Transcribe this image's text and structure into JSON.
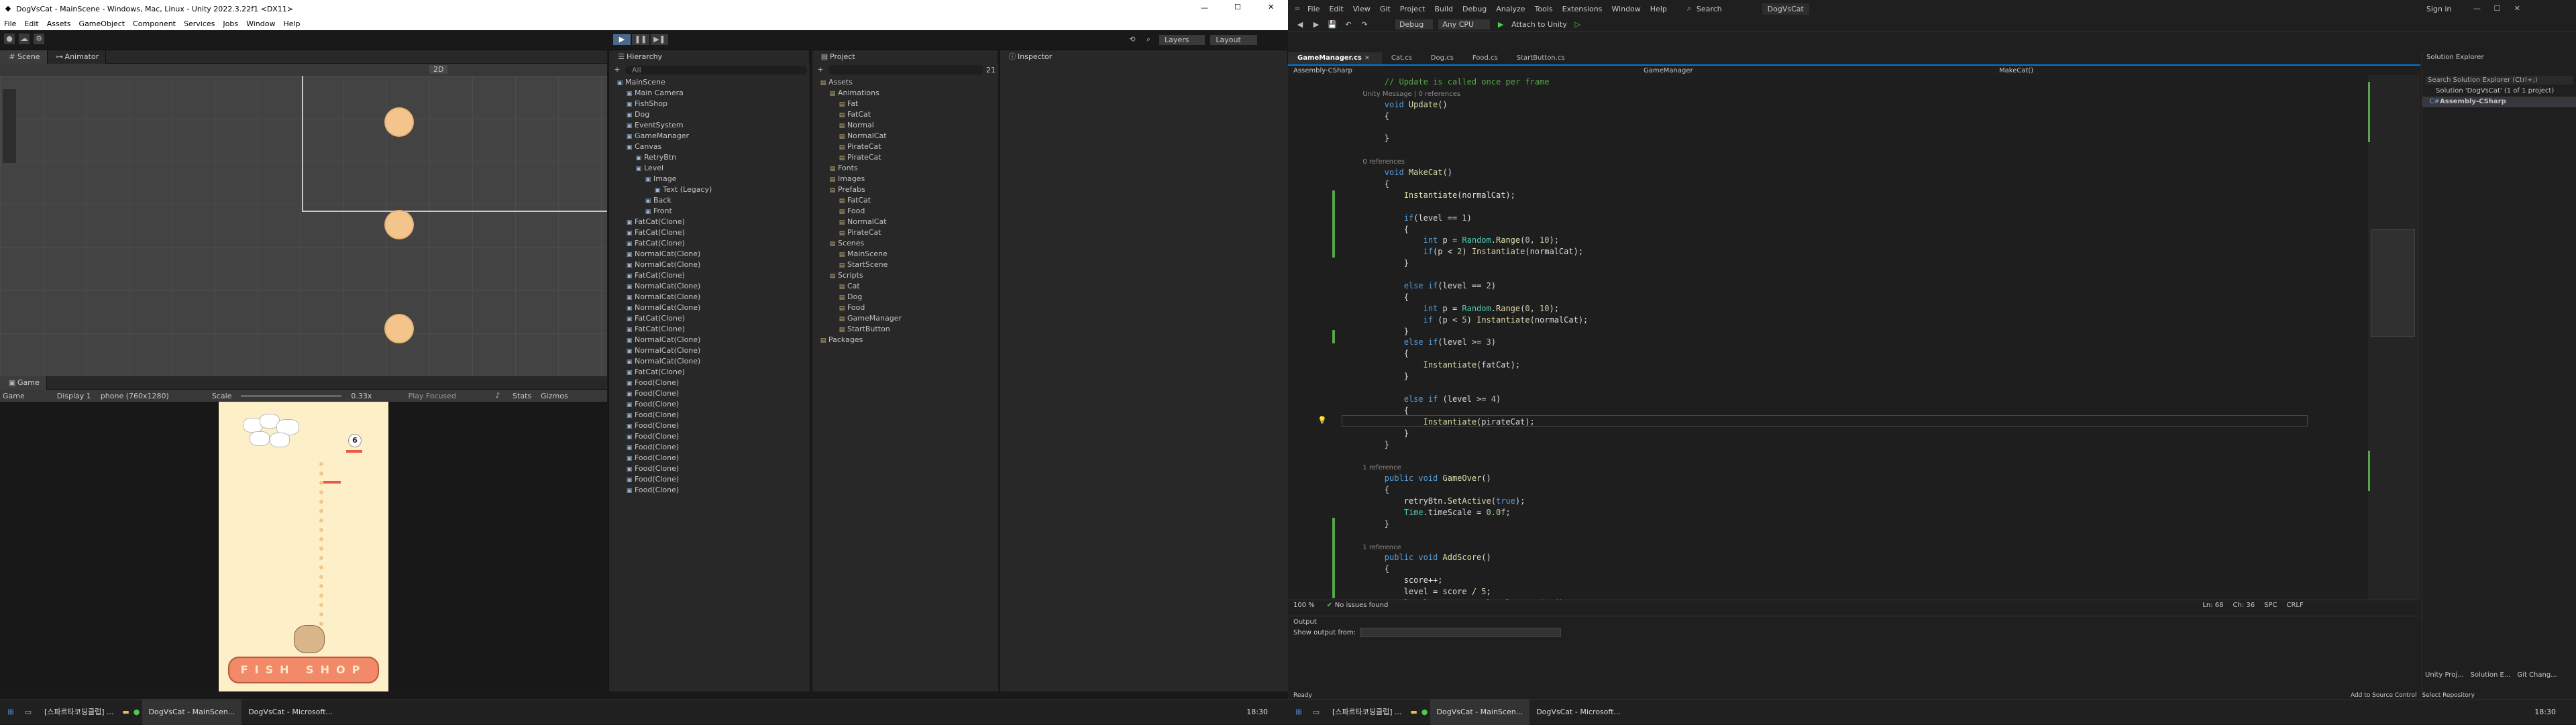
{
  "unity": {
    "title": "DogVsCat - MainScene - Windows, Mac, Linux - Unity 2022.3.22f1 <DX11>",
    "menu": [
      "File",
      "Edit",
      "Assets",
      "GameObject",
      "Component",
      "Services",
      "Jobs",
      "Window",
      "Help"
    ],
    "toolbar": {
      "layers": "Layers",
      "layout": "Layout"
    },
    "scene_tabs": [
      "Scene",
      "Animator"
    ],
    "scene_zoom": "2D",
    "hierarchy": {
      "title": "Hierarchy",
      "search_placeholder": "All",
      "rows": [
        {
          "d": 0,
          "t": "MainScene"
        },
        {
          "d": 1,
          "t": "Main Camera"
        },
        {
          "d": 1,
          "t": "FishShop"
        },
        {
          "d": 1,
          "t": "Dog"
        },
        {
          "d": 1,
          "t": "EventSystem"
        },
        {
          "d": 1,
          "t": "GameManager"
        },
        {
          "d": 1,
          "t": "Canvas"
        },
        {
          "d": 2,
          "t": "RetryBtn"
        },
        {
          "d": 2,
          "t": "Level"
        },
        {
          "d": 3,
          "t": "Image"
        },
        {
          "d": 4,
          "t": "Text (Legacy)"
        },
        {
          "d": 3,
          "t": "Back"
        },
        {
          "d": 3,
          "t": "Front"
        },
        {
          "d": 1,
          "t": "FatCat(Clone)"
        },
        {
          "d": 1,
          "t": "FatCat(Clone)"
        },
        {
          "d": 1,
          "t": "FatCat(Clone)"
        },
        {
          "d": 1,
          "t": "NormalCat(Clone)"
        },
        {
          "d": 1,
          "t": "NormalCat(Clone)"
        },
        {
          "d": 1,
          "t": "FatCat(Clone)"
        },
        {
          "d": 1,
          "t": "NormalCat(Clone)"
        },
        {
          "d": 1,
          "t": "NormalCat(Clone)"
        },
        {
          "d": 1,
          "t": "NormalCat(Clone)"
        },
        {
          "d": 1,
          "t": "FatCat(Clone)"
        },
        {
          "d": 1,
          "t": "FatCat(Clone)"
        },
        {
          "d": 1,
          "t": "NormalCat(Clone)"
        },
        {
          "d": 1,
          "t": "NormalCat(Clone)"
        },
        {
          "d": 1,
          "t": "NormalCat(Clone)"
        },
        {
          "d": 1,
          "t": "FatCat(Clone)"
        },
        {
          "d": 1,
          "t": "Food(Clone)"
        },
        {
          "d": 1,
          "t": "Food(Clone)"
        },
        {
          "d": 1,
          "t": "Food(Clone)"
        },
        {
          "d": 1,
          "t": "Food(Clone)"
        },
        {
          "d": 1,
          "t": "Food(Clone)"
        },
        {
          "d": 1,
          "t": "Food(Clone)"
        },
        {
          "d": 1,
          "t": "Food(Clone)"
        },
        {
          "d": 1,
          "t": "Food(Clone)"
        },
        {
          "d": 1,
          "t": "Food(Clone)"
        },
        {
          "d": 1,
          "t": "Food(Clone)"
        },
        {
          "d": 1,
          "t": "Food(Clone)"
        }
      ]
    },
    "project": {
      "title": "Project",
      "count": "21",
      "rows": [
        {
          "d": 0,
          "t": "Assets"
        },
        {
          "d": 1,
          "t": "Animations"
        },
        {
          "d": 2,
          "t": "Fat"
        },
        {
          "d": 2,
          "t": "FatCat"
        },
        {
          "d": 2,
          "t": "Normal"
        },
        {
          "d": 2,
          "t": "NormalCat"
        },
        {
          "d": 2,
          "t": "PirateCat"
        },
        {
          "d": 2,
          "t": "PirateCat"
        },
        {
          "d": 1,
          "t": "Fonts"
        },
        {
          "d": 1,
          "t": "Images"
        },
        {
          "d": 1,
          "t": "Prefabs"
        },
        {
          "d": 2,
          "t": "FatCat"
        },
        {
          "d": 2,
          "t": "Food"
        },
        {
          "d": 2,
          "t": "NormalCat"
        },
        {
          "d": 2,
          "t": "PirateCat"
        },
        {
          "d": 1,
          "t": "Scenes"
        },
        {
          "d": 2,
          "t": "MainScene"
        },
        {
          "d": 2,
          "t": "StartScene"
        },
        {
          "d": 1,
          "t": "Scripts"
        },
        {
          "d": 2,
          "t": "Cat"
        },
        {
          "d": 2,
          "t": "Dog"
        },
        {
          "d": 2,
          "t": "Food"
        },
        {
          "d": 2,
          "t": "GameManager"
        },
        {
          "d": 2,
          "t": "StartButton"
        },
        {
          "d": 0,
          "t": "Packages"
        }
      ]
    },
    "inspector": {
      "title": "Inspector"
    },
    "game": {
      "tab": "Game",
      "mode": "Game",
      "display": "Display 1",
      "resolution": "phone (760x1280)",
      "scale_label": "Scale",
      "scale_value": "0.33x",
      "play_focused": "Play Focused",
      "stats": "Stats",
      "gizmos": "Gizmos",
      "level": "6",
      "shop_text": "FISH SHOP"
    }
  },
  "vs": {
    "menu": [
      "File",
      "Edit",
      "View",
      "Git",
      "Project",
      "Build",
      "Debug",
      "Analyze",
      "Tools",
      "Extensions",
      "Window",
      "Help"
    ],
    "search": "Search",
    "solution_name": "DogVsCat",
    "signin": "Sign in",
    "toolbar": {
      "config": "Debug",
      "platform": "Any CPU",
      "attach": "Attach to Unity"
    },
    "tabs": [
      "GameManager.cs",
      "Cat.cs",
      "Dog.cs",
      "Food.cs",
      "StartButton.cs"
    ],
    "nav": {
      "project": "Assembly-CSharp",
      "class": "GameManager",
      "member": "MakeCat()"
    },
    "code": [
      {
        "n": "",
        "parts": [
          [
            "cm",
            "        // Update is called once per frame"
          ]
        ]
      },
      {
        "n": "",
        "parts": [
          [
            "gr",
            "        Unity Message | 0 references"
          ]
        ]
      },
      {
        "n": "",
        "parts": [
          [
            "kw",
            "        void "
          ],
          [
            "mt",
            "Update"
          ],
          [
            "",
            "()"
          ]
        ]
      },
      {
        "n": "",
        "parts": [
          [
            "",
            "        {"
          ]
        ]
      },
      {
        "n": "",
        "parts": [
          [
            "",
            ""
          ]
        ]
      },
      {
        "n": "",
        "parts": [
          [
            "",
            "        }"
          ]
        ]
      },
      {
        "n": "",
        "parts": [
          [
            "",
            ""
          ]
        ]
      },
      {
        "n": "",
        "parts": [
          [
            "gr",
            "        0 references"
          ]
        ]
      },
      {
        "n": "",
        "parts": [
          [
            "kw",
            "        void "
          ],
          [
            "mt",
            "MakeCat"
          ],
          [
            "",
            "()"
          ]
        ]
      },
      {
        "n": "",
        "parts": [
          [
            "",
            "        {"
          ]
        ]
      },
      {
        "n": "",
        "parts": [
          [
            "",
            "            "
          ],
          [
            "mt",
            "Instantiate"
          ],
          [
            "",
            "(normalCat);"
          ]
        ]
      },
      {
        "n": "",
        "parts": [
          [
            "",
            ""
          ]
        ]
      },
      {
        "n": "",
        "parts": [
          [
            "kw",
            "            if"
          ],
          [
            "",
            "(level == "
          ],
          [
            "nm",
            "1"
          ],
          [
            "",
            ")"
          ]
        ]
      },
      {
        "n": "",
        "parts": [
          [
            "",
            "            {"
          ]
        ]
      },
      {
        "n": "",
        "parts": [
          [
            "kw",
            "                int "
          ],
          [
            "",
            "p = "
          ],
          [
            "ty",
            "Random"
          ],
          [
            "",
            "."
          ],
          [
            "mt",
            "Range"
          ],
          [
            "",
            "("
          ],
          [
            "nm",
            "0"
          ],
          [
            "",
            ", "
          ],
          [
            "nm",
            "10"
          ],
          [
            "",
            ");"
          ]
        ]
      },
      {
        "n": "",
        "parts": [
          [
            "kw",
            "                if"
          ],
          [
            "",
            "(p < "
          ],
          [
            "nm",
            "2"
          ],
          [
            "",
            ") "
          ],
          [
            "mt",
            "Instantiate"
          ],
          [
            "",
            "(normalCat);"
          ]
        ]
      },
      {
        "n": "",
        "parts": [
          [
            "",
            "            }"
          ]
        ]
      },
      {
        "n": "",
        "parts": [
          [
            "",
            ""
          ]
        ]
      },
      {
        "n": "",
        "parts": [
          [
            "kw",
            "            else if"
          ],
          [
            "",
            "(level == "
          ],
          [
            "nm",
            "2"
          ],
          [
            "",
            ")"
          ]
        ]
      },
      {
        "n": "",
        "parts": [
          [
            "",
            "            {"
          ]
        ]
      },
      {
        "n": "",
        "parts": [
          [
            "kw",
            "                int "
          ],
          [
            "",
            "p = "
          ],
          [
            "ty",
            "Random"
          ],
          [
            "",
            "."
          ],
          [
            "mt",
            "Range"
          ],
          [
            "",
            "("
          ],
          [
            "nm",
            "0"
          ],
          [
            "",
            ", "
          ],
          [
            "nm",
            "10"
          ],
          [
            "",
            ");"
          ]
        ]
      },
      {
        "n": "",
        "parts": [
          [
            "kw",
            "                if "
          ],
          [
            "",
            "(p < "
          ],
          [
            "nm",
            "5"
          ],
          [
            "",
            ") "
          ],
          [
            "mt",
            "Instantiate"
          ],
          [
            "",
            "(normalCat);"
          ]
        ]
      },
      {
        "n": "",
        "parts": [
          [
            "",
            "            }"
          ]
        ]
      },
      {
        "n": "",
        "parts": [
          [
            "kw",
            "            else if"
          ],
          [
            "",
            "(level >= "
          ],
          [
            "nm",
            "3"
          ],
          [
            "",
            ")"
          ]
        ]
      },
      {
        "n": "",
        "parts": [
          [
            "",
            "            {"
          ]
        ]
      },
      {
        "n": "",
        "parts": [
          [
            "",
            "                "
          ],
          [
            "mt",
            "Instantiate"
          ],
          [
            "",
            "(fatCat);"
          ]
        ]
      },
      {
        "n": "",
        "parts": [
          [
            "",
            "            }"
          ]
        ]
      },
      {
        "n": "",
        "parts": [
          [
            "",
            ""
          ]
        ]
      },
      {
        "n": "",
        "parts": [
          [
            "kw",
            "            else if "
          ],
          [
            "",
            "(level >= "
          ],
          [
            "nm",
            "4"
          ],
          [
            "",
            ")"
          ]
        ]
      },
      {
        "n": "",
        "parts": [
          [
            "",
            "            {"
          ]
        ]
      },
      {
        "n": "",
        "parts": [
          [
            "",
            "                "
          ],
          [
            "mt",
            "Instantiate"
          ],
          [
            "",
            "(pirateCat);"
          ]
        ]
      },
      {
        "n": "",
        "parts": [
          [
            "",
            "            }"
          ]
        ]
      },
      {
        "n": "",
        "parts": [
          [
            "",
            "        }"
          ]
        ]
      },
      {
        "n": "",
        "parts": [
          [
            "",
            ""
          ]
        ]
      },
      {
        "n": "",
        "parts": [
          [
            "gr",
            "        1 reference"
          ]
        ]
      },
      {
        "n": "",
        "parts": [
          [
            "kw",
            "        public void "
          ],
          [
            "mt",
            "GameOver"
          ],
          [
            "",
            "()"
          ]
        ]
      },
      {
        "n": "",
        "parts": [
          [
            "",
            "        {"
          ]
        ]
      },
      {
        "n": "",
        "parts": [
          [
            "",
            "            retryBtn."
          ],
          [
            "mt",
            "SetActive"
          ],
          [
            "",
            "("
          ],
          [
            "kw",
            "true"
          ],
          [
            "",
            ");"
          ]
        ]
      },
      {
        "n": "",
        "parts": [
          [
            "",
            "            "
          ],
          [
            "ty",
            "Time"
          ],
          [
            "",
            ".timeScale = "
          ],
          [
            "nm",
            "0.0f"
          ],
          [
            "",
            ";"
          ]
        ]
      },
      {
        "n": "",
        "parts": [
          [
            "",
            "        }"
          ]
        ]
      },
      {
        "n": "",
        "parts": [
          [
            "",
            ""
          ]
        ]
      },
      {
        "n": "",
        "parts": [
          [
            "gr",
            "        1 reference"
          ]
        ]
      },
      {
        "n": "",
        "parts": [
          [
            "kw",
            "        public void "
          ],
          [
            "mt",
            "AddScore"
          ],
          [
            "",
            "()"
          ]
        ]
      },
      {
        "n": "",
        "parts": [
          [
            "",
            "        {"
          ]
        ]
      },
      {
        "n": "",
        "parts": [
          [
            "",
            "            score++;"
          ]
        ]
      },
      {
        "n": "",
        "parts": [
          [
            "",
            "            level = score / "
          ],
          [
            "nm",
            "5"
          ],
          [
            "",
            ";"
          ]
        ]
      },
      {
        "n": "",
        "parts": [
          [
            "",
            "            levelText.text = level."
          ],
          [
            "mt",
            "ToString"
          ],
          [
            "",
            "();"
          ]
        ]
      }
    ],
    "status_strip": {
      "zoom": "100 %",
      "issues": "No issues found",
      "ln": "Ln: 68",
      "ch": "Ch: 36",
      "spc": "SPC",
      "crlf": "CRLF"
    },
    "output": {
      "title": "Output",
      "show_from": "Show output from:"
    },
    "solution_explorer": {
      "title": "Solution Explorer",
      "search": "Search Solution Explorer (Ctrl+;)",
      "solution": "Solution 'DogVsCat' (1 of 1 project)",
      "project": "Assembly-CSharp",
      "bottom_tabs": [
        "Unity Proj...",
        "Solution E...",
        "Git Chang..."
      ]
    },
    "statusbar": {
      "ready": "Ready",
      "add_source": "Add to Source Control",
      "repo": "Select Repository"
    }
  },
  "taskbar_left": {
    "items": [
      "[스파르타코딩클럽] ...",
      "DogVsCat - MainScen...",
      "DogVsCat - Microsoft..."
    ],
    "time": "18:30"
  },
  "taskbar_right": {
    "items": [
      "[스파르타코딩클럽] ...",
      "DogVsCat - MainScen...",
      "DogVsCat - Microsoft..."
    ],
    "time": "18:30"
  },
  "colors": {
    "unity_bg": "#191919",
    "vs_bg": "#1f1f1f",
    "accent": "#0078d4",
    "paw": "#f3c48c",
    "game_bg": "#fdf0c8"
  }
}
